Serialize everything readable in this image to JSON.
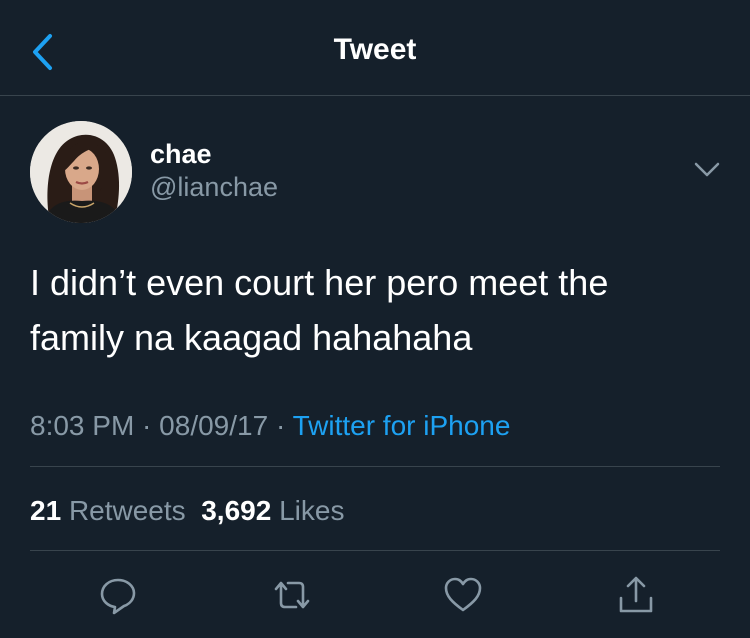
{
  "header": {
    "title": "Tweet"
  },
  "user": {
    "display_name": "chae",
    "handle": "@lianchae"
  },
  "tweet": {
    "line1": "I didn’t even court her pero meet the",
    "line2": "family na kaagad hahahaha"
  },
  "meta": {
    "time": "8:03 PM",
    "sep1": " · ",
    "date": "08/09/17",
    "sep2": " · ",
    "source": "Twitter for iPhone"
  },
  "stats": {
    "retweets_count": "21",
    "retweets_label": "Retweets",
    "likes_count": "3,692",
    "likes_label": "Likes"
  },
  "colors": {
    "background": "#15202b",
    "accent": "#1da1f2",
    "secondary_text": "#8899a6",
    "divider": "#38444d"
  },
  "icons": [
    "back-arrow-icon",
    "chevron-down-icon",
    "reply-icon",
    "retweet-icon",
    "like-icon",
    "share-icon"
  ]
}
